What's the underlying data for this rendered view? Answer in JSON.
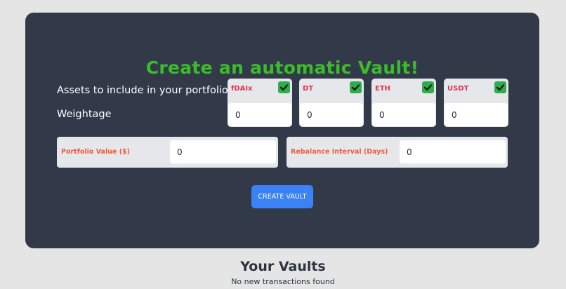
{
  "vault_form": {
    "title": "Create an automatic Vault!",
    "assets_label": "Assets to include in your portfolio",
    "weightage_label": "Weightage",
    "assets": [
      {
        "name": "fDAIx",
        "checked": true,
        "weight": "0"
      },
      {
        "name": "DT",
        "checked": true,
        "weight": "0"
      },
      {
        "name": "ETH",
        "checked": true,
        "weight": "0"
      },
      {
        "name": "USDT",
        "checked": true,
        "weight": "0"
      }
    ],
    "portfolio_value": {
      "label": "Portfolio Value ($)",
      "value": "0"
    },
    "rebalance_interval": {
      "label": "Rebalance Interval (Days)",
      "value": "0"
    },
    "create_button": "CREATE VAULT"
  },
  "vaults": {
    "title": "Your Vaults",
    "empty_message": "No new transactions found"
  },
  "colors": {
    "page_bg": "#e5e5e5",
    "card_bg": "#323a4a",
    "title_green": "#3bbd2a",
    "asset_name_red": "#e0364f",
    "field_label_orange": "#f05a3c",
    "check_green": "#2fad4e",
    "button_blue": "#3b82f6"
  },
  "icons": {
    "asset_checkbox": "check-icon"
  }
}
